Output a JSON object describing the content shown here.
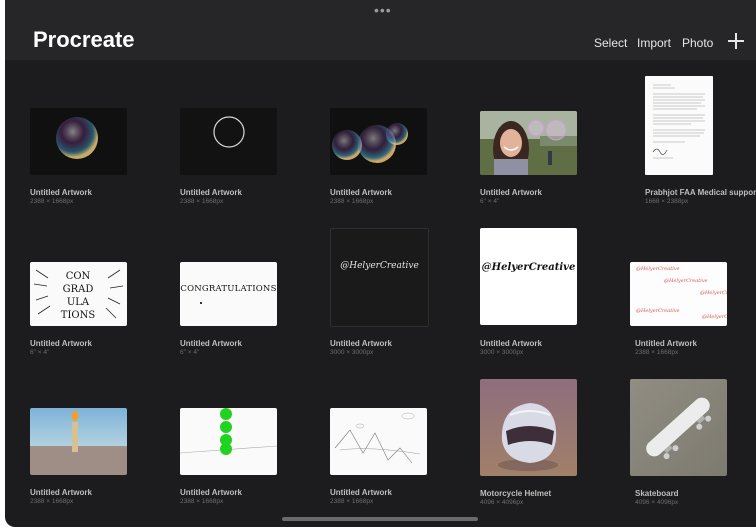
{
  "header": {
    "title": "Procreate",
    "select_label": "Select",
    "import_label": "Import",
    "photo_label": "Photo",
    "add_icon": "plus-icon",
    "multitask_icon": "more-dots-icon"
  },
  "gallery": [
    {
      "name": "Untitled Artwork",
      "dims": "2388 × 1668px",
      "thumb": "bubble"
    },
    {
      "name": "Untitled Artwork",
      "dims": "2388 × 1668px",
      "thumb": "circle"
    },
    {
      "name": "Untitled Artwork",
      "dims": "2388 × 1668px",
      "thumb": "bubbles"
    },
    {
      "name": "Untitled Artwork",
      "dims": "6\" × 4\"",
      "thumb": "photo"
    },
    {
      "name": "Prabhjot FAA Medical support le",
      "dims": "1668 × 2388px",
      "thumb": "document"
    },
    {
      "name": "Untitled Artwork",
      "dims": "6\" × 4\"",
      "thumb": "congrad-lettering",
      "text": "CON GRAD ULA TIONS"
    },
    {
      "name": "Untitled Artwork",
      "dims": "6\" × 4\"",
      "thumb": "congratulations",
      "text": "CONGRATULATIONS"
    },
    {
      "name": "Untitled Artwork",
      "dims": "3000 × 3000px",
      "thumb": "dark-signature",
      "text": "@HelyerCreative"
    },
    {
      "name": "Untitled Artwork",
      "dims": "3000 × 3000px",
      "thumb": "signature",
      "text": "@HelyerCreative"
    },
    {
      "name": "Untitled Artwork",
      "dims": "2388 × 1668px",
      "thumb": "pattern",
      "text": "@HelyerCreative"
    },
    {
      "name": "Untitled Artwork",
      "dims": "2388 × 1668px",
      "thumb": "candle"
    },
    {
      "name": "Untitled Artwork",
      "dims": "2388 × 1668px",
      "thumb": "green-dots"
    },
    {
      "name": "Untitled Artwork",
      "dims": "2388 × 1668px",
      "thumb": "sketch"
    },
    {
      "name": "Motorcycle Helmet",
      "dims": "4096 × 4096px",
      "thumb": "helmet"
    },
    {
      "name": "Skateboard",
      "dims": "4096 × 4096px",
      "thumb": "skateboard"
    }
  ],
  "colors": {
    "background": "#1c1c1e",
    "header": "#262628",
    "text": "#ffffff"
  }
}
